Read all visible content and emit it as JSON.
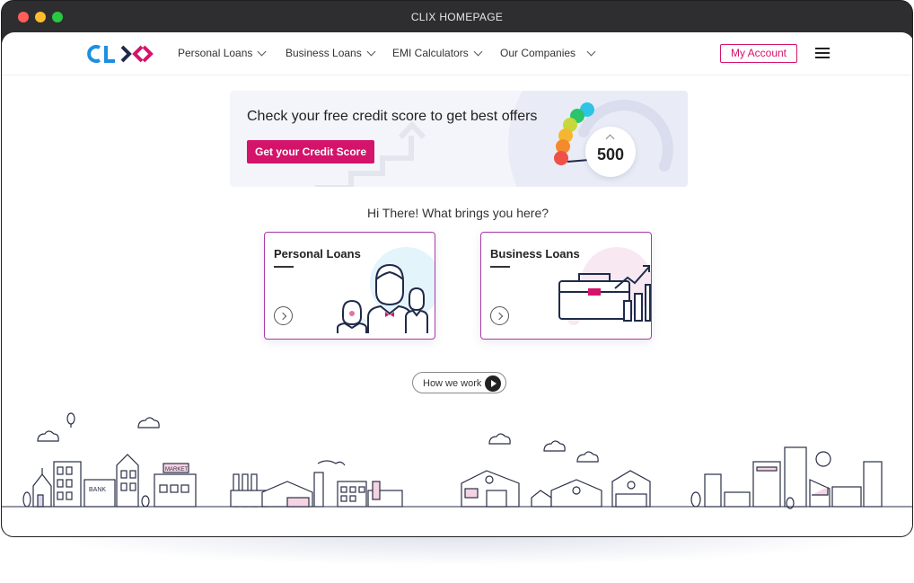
{
  "window": {
    "title": "CLIX HOMEPAGE"
  },
  "brand": {
    "logo_text": "CLIX",
    "primary": "#d4146b",
    "blue": "#1d8fe0",
    "navy": "#1f2a4a"
  },
  "nav": {
    "items": [
      {
        "label": "Personal Loans"
      },
      {
        "label": "Business Loans"
      },
      {
        "label": "EMI Calculators"
      },
      {
        "label": "Our Companies"
      }
    ],
    "account_label": "My Account"
  },
  "banner": {
    "headline": "Check your free credit score to get best offers",
    "cta_label": "Get your Credit Score",
    "score": "500"
  },
  "main": {
    "greeting": "Hi There! What brings you here?",
    "cards": [
      {
        "title": "Personal Loans"
      },
      {
        "title": "Business Loans"
      }
    ],
    "how_label": "How we work"
  },
  "city": {
    "bank_label": "BANK",
    "market_label": "MARKET"
  }
}
